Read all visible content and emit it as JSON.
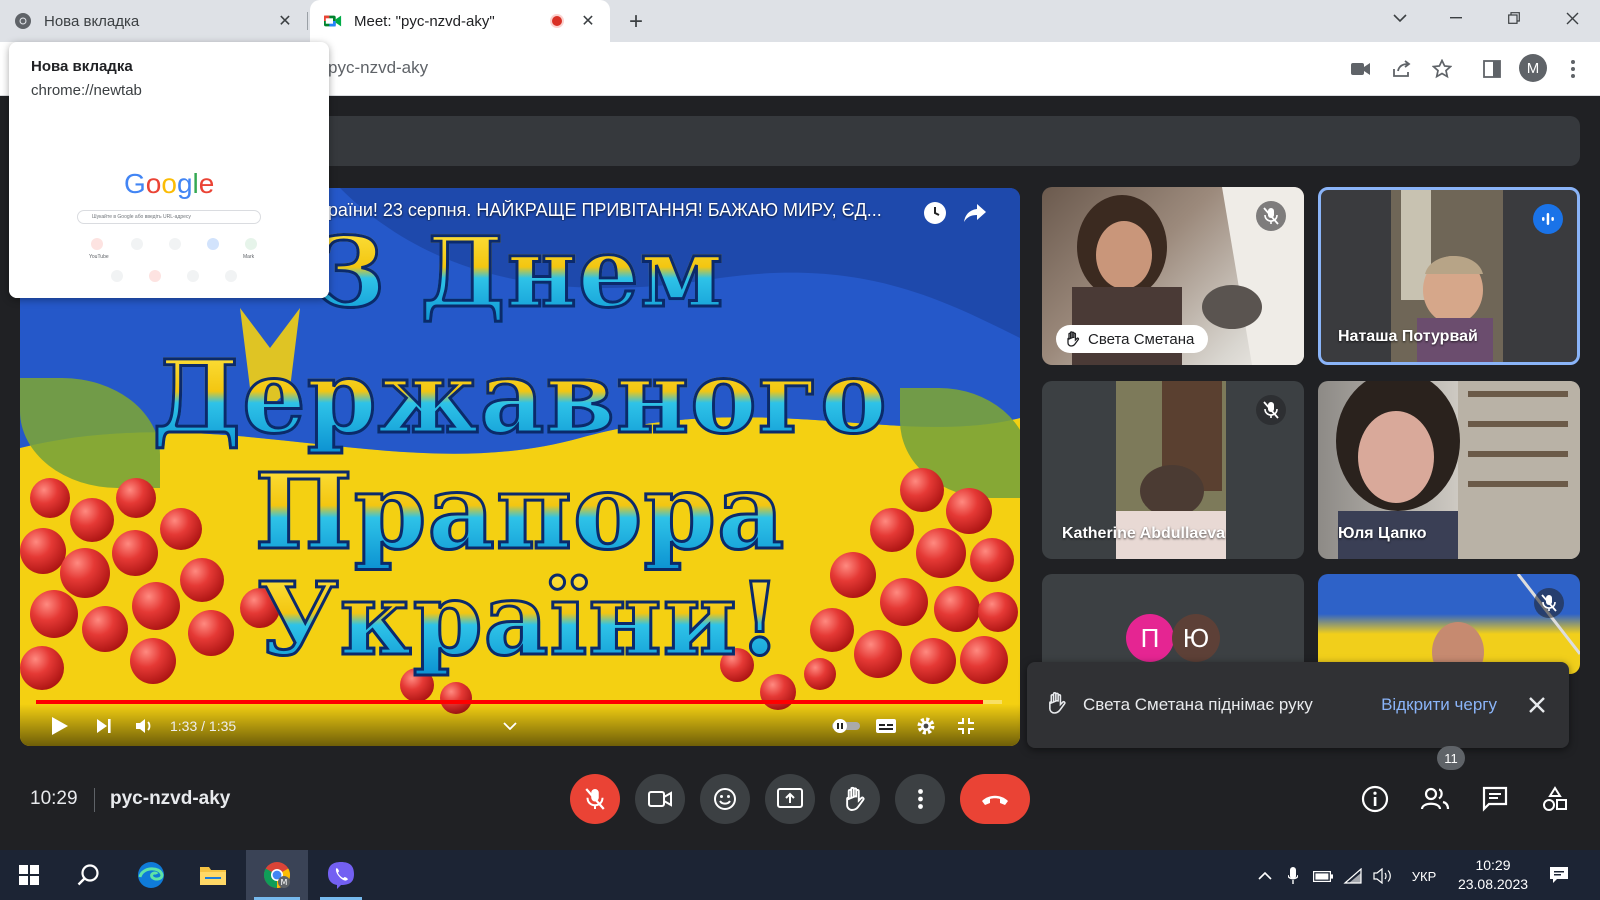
{
  "browser": {
    "tabs": [
      {
        "title": "Нова вкладка"
      },
      {
        "title": "Meet: \"pyc-nzvd-aky\""
      }
    ],
    "address": "pyc-nzvd-aky",
    "profile_initial": "M"
  },
  "hovercard": {
    "title": "Нова вкладка",
    "url": "chrome://newtab",
    "google_logo": "Google",
    "search_placeholder": "Шукайте в Google або введіть URL-адресу",
    "shortcuts": [
      "YouTube",
      "",
      "",
      "",
      "Mark"
    ]
  },
  "video": {
    "title": "країни! 23 серпня. НАЙКРАЩЕ ПРИВІТАННЯ! БАЖАЮ МИРУ, ЄД...",
    "lines": [
      "З Днем",
      "Державного",
      "Прапора",
      "України!"
    ],
    "time": "1:33 / 1:35",
    "progress": 0.98
  },
  "participants": [
    {
      "name": "Света Сметана",
      "hand_raised": true,
      "muted": true
    },
    {
      "name": "Наташа Потурвай",
      "speaking": true
    },
    {
      "name": "Katherine Abdullaeva",
      "muted": true
    },
    {
      "name": "Юля Цапко"
    },
    {
      "initials": [
        "П",
        "Ю"
      ]
    },
    {
      "muted": true
    }
  ],
  "toast": {
    "message": "Света Сметана піднімає руку",
    "action": "Відкрити чергу"
  },
  "meeting": {
    "time": "10:29",
    "code": "pyc-nzvd-aky",
    "participant_count": "11"
  },
  "taskbar": {
    "language": "УКР",
    "time": "10:29",
    "date": "23.08.2023"
  },
  "colors": {
    "meet_bg": "#202124",
    "danger": "#ea4335",
    "accent": "#8ab4f8",
    "taskbar": "#1c2434"
  }
}
